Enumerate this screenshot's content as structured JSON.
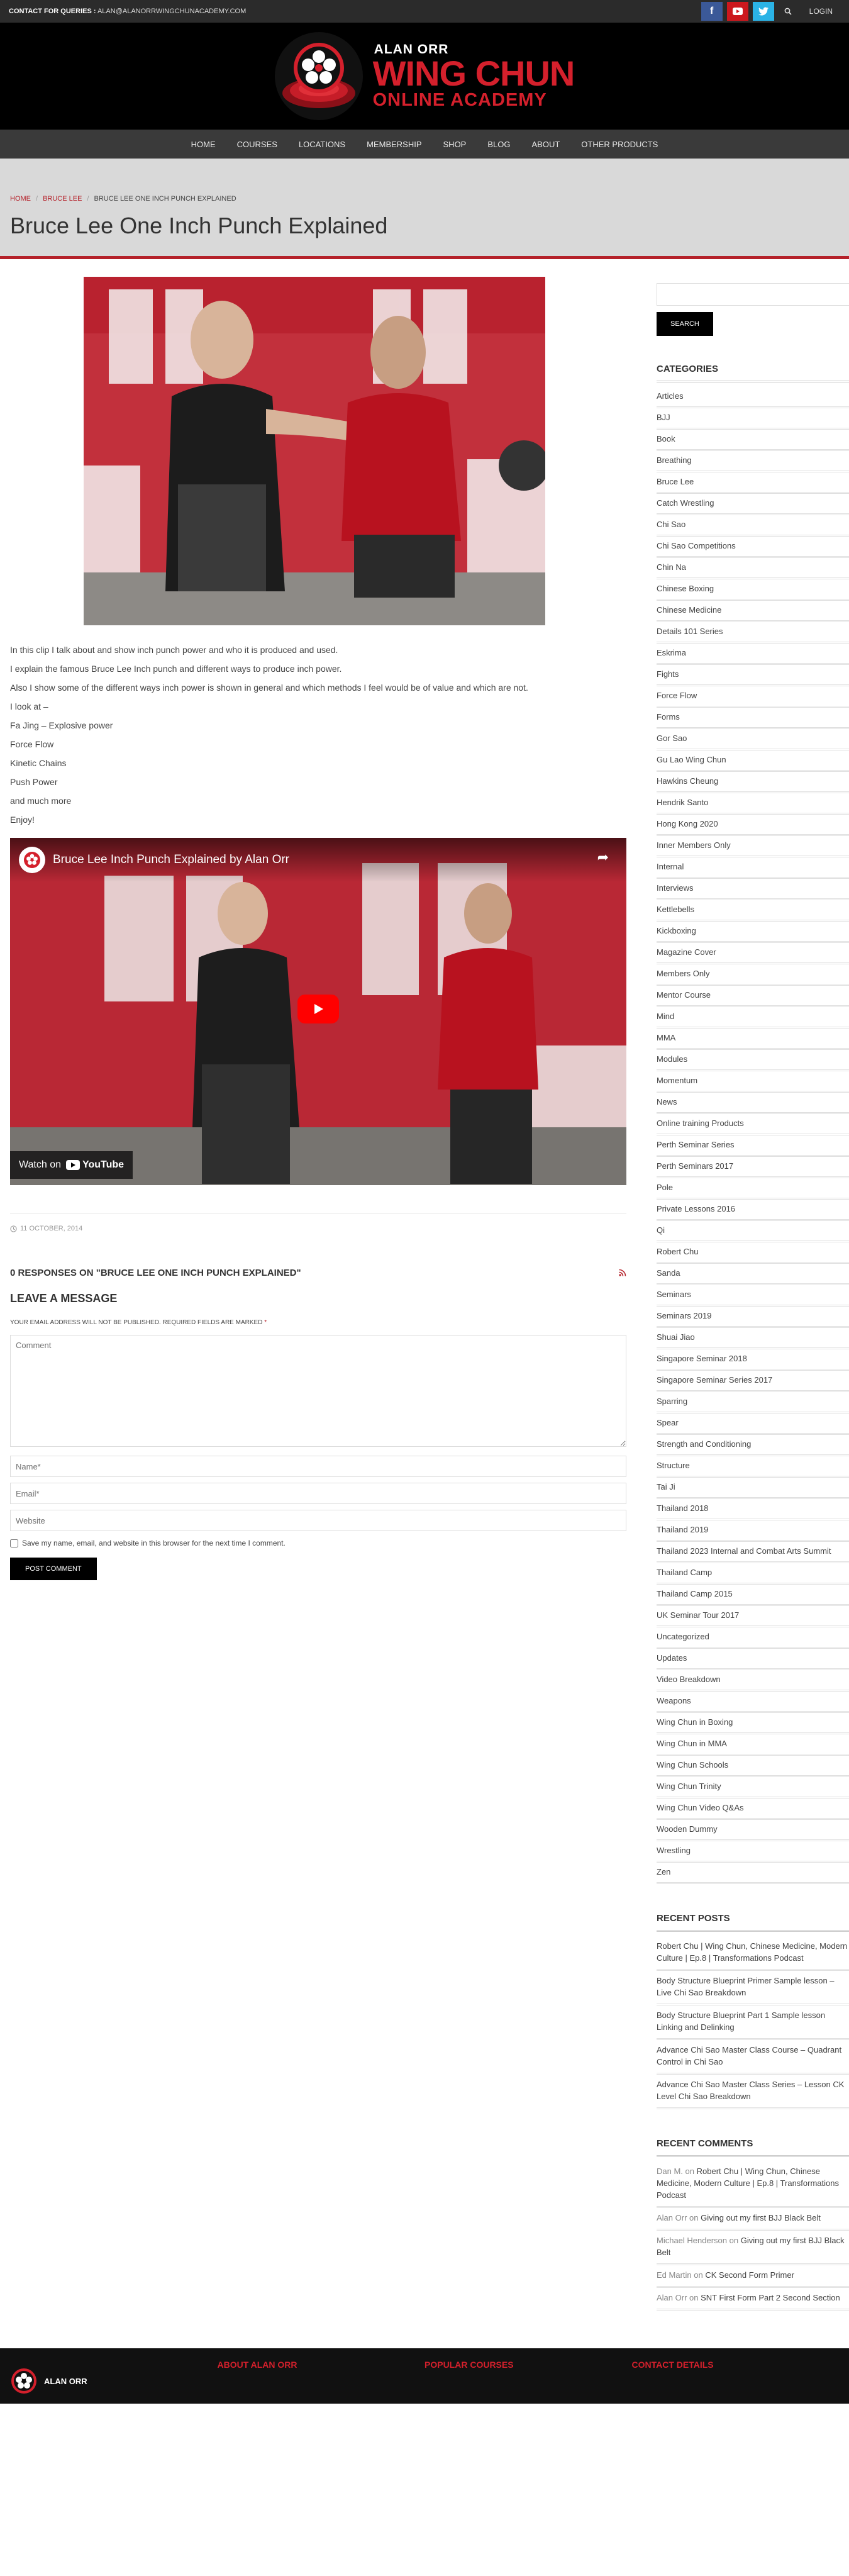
{
  "topbar": {
    "contact_label": "CONTACT FOR QUERIES :",
    "contact_email": "ALAN@ALANORRWINGCHUNACADEMY.COM",
    "social": [
      "facebook-icon",
      "youtube-icon",
      "twitter-icon"
    ],
    "login": "LOGIN"
  },
  "logo": {
    "small": "ALAN ORR",
    "big": "WING CHUN",
    "sub": "ONLINE ACADEMY"
  },
  "nav": [
    "HOME",
    "COURSES",
    "LOCATIONS",
    "MEMBERSHIP",
    "SHOP",
    "BLOG",
    "ABOUT",
    "OTHER PRODUCTS"
  ],
  "breadcrumb": {
    "home": "HOME",
    "sep": "/",
    "cat": "BRUCE LEE",
    "current": "BRUCE LEE ONE INCH PUNCH EXPLAINED"
  },
  "page_title": "Bruce Lee One Inch Punch Explained",
  "article": {
    "paragraphs": [
      "In this clip I talk about and show inch punch power and who it is produced and used.",
      "I explain the famous Bruce Lee Inch punch and different ways to produce inch power.",
      "Also I show some of the different ways inch power is shown in general and which methods I feel would be of value and which are not.",
      "I look at –",
      "Fa Jing – Explosive power",
      "Force Flow",
      "Kinetic Chains",
      "Push Power",
      "and much more",
      "Enjoy!"
    ],
    "video_title": "Bruce Lee Inch Punch Explained by Alan Orr",
    "watch_on": "Watch on",
    "youtube": "YouTube",
    "date": "11 OCTOBER, 2014"
  },
  "comments": {
    "responses": "0 RESPONSES ON \"BRUCE LEE ONE INCH PUNCH EXPLAINED\"",
    "leave": "LEAVE A MESSAGE",
    "note": "YOUR EMAIL ADDRESS WILL NOT BE PUBLISHED. REQUIRED FIELDS ARE MARKED",
    "req": "*",
    "comment_ph": "Comment",
    "name_ph": "Name*",
    "email_ph": "Email*",
    "website_ph": "Website",
    "consent": "Save my name, email, and website in this browser for the next time I comment.",
    "post": "POST COMMENT"
  },
  "sidebar": {
    "search_btn": "SEARCH",
    "categories_title": "CATEGORIES",
    "categories": [
      "Articles",
      "BJJ",
      "Book",
      "Breathing",
      "Bruce Lee",
      "Catch Wrestling",
      "Chi Sao",
      "Chi Sao Competitions",
      "Chin Na",
      "Chinese Boxing",
      "Chinese Medicine",
      "Details 101 Series",
      "Eskrima",
      "Fights",
      "Force Flow",
      "Forms",
      "Gor Sao",
      "Gu Lao Wing Chun",
      "Hawkins Cheung",
      "Hendrik Santo",
      "Hong Kong 2020",
      "Inner Members Only",
      "Internal",
      "Interviews",
      "Kettlebells",
      "Kickboxing",
      "Magazine Cover",
      "Members Only",
      "Mentor Course",
      "Mind",
      "MMA",
      "Modules",
      "Momentum",
      "News",
      "Online training Products",
      "Perth Seminar Series",
      "Perth Seminars 2017",
      "Pole",
      "Private Lessons 2016",
      "Qi",
      "Robert Chu",
      "Sanda",
      "Seminars",
      "Seminars 2019",
      "Shuai Jiao",
      "Singapore Seminar 2018",
      "Singapore Seminar Series 2017",
      "Sparring",
      "Spear",
      "Strength and Conditioning",
      "Structure",
      "Tai Ji",
      "Thailand 2018",
      "Thailand 2019",
      "Thailand 2023 Internal and Combat Arts Summit",
      "Thailand Camp",
      "Thailand Camp 2015",
      "UK Seminar Tour 2017",
      "Uncategorized",
      "Updates",
      "Video Breakdown",
      "Weapons",
      "Wing Chun in Boxing",
      "Wing Chun in MMA",
      "Wing Chun Schools",
      "Wing Chun Trinity",
      "Wing Chun Video Q&As",
      "Wooden Dummy",
      "Wrestling",
      "Zen"
    ],
    "recent_posts_title": "RECENT POSTS",
    "recent_posts": [
      "Robert Chu | Wing Chun, Chinese Medicine, Modern Culture | Ep.8 | Transformations Podcast",
      "Body Structure Blueprint Primer Sample lesson – Live Chi Sao Breakdown",
      "Body Structure Blueprint Part 1 Sample lesson Linking and Delinking",
      "Advance Chi Sao Master Class Course – Quadrant Control in Chi Sao",
      "Advance Chi Sao Master Class Series – Lesson CK Level Chi Sao Breakdown"
    ],
    "recent_comments_title": "RECENT COMMENTS",
    "recent_comments": [
      {
        "author": "Dan M.",
        "on": "on",
        "post": "Robert Chu | Wing Chun, Chinese Medicine, Modern Culture | Ep.8 | Transformations Podcast"
      },
      {
        "author": "Alan Orr",
        "on": "on",
        "post": "Giving out my first BJJ Black Belt"
      },
      {
        "author": "Michael Henderson",
        "on": "on",
        "post": "Giving out my first BJJ Black Belt"
      },
      {
        "author": "Ed Martin",
        "on": "on",
        "post": "CK Second Form Primer"
      },
      {
        "author": "Alan Orr",
        "on": "on",
        "post": "SNT First Form Part 2 Second Section"
      }
    ]
  },
  "footer": {
    "logo_text": "ALAN ORR",
    "cols": [
      "ABOUT ALAN ORR",
      "POPULAR COURSES",
      "CONTACT DETAILS"
    ]
  }
}
